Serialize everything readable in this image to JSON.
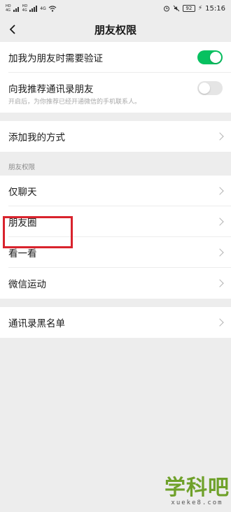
{
  "status_bar": {
    "left_tags": [
      "HD",
      "4G",
      "HD",
      "4G",
      "4G"
    ],
    "battery": "92",
    "time": "15:16"
  },
  "nav": {
    "title": "朋友权限",
    "back_icon": "back-arrow-icon"
  },
  "verification": {
    "require_verify_label": "加我为朋友时需要验证",
    "require_verify_on": true,
    "recommend_contacts_label": "向我推荐通讯录朋友",
    "recommend_contacts_on": false,
    "recommend_hint": "开启后，为你推荐已经开通微信的手机联系人。"
  },
  "add_methods": {
    "label": "添加我的方式"
  },
  "friend_permissions": {
    "section_label": "朋友权限",
    "items": [
      {
        "label": "仅聊天"
      },
      {
        "label": "朋友圈"
      },
      {
        "label": "看一看"
      },
      {
        "label": "微信运动"
      }
    ]
  },
  "blacklist": {
    "label": "通讯录黑名单"
  },
  "watermark": {
    "main": "学科吧",
    "sub": "xueke8.com"
  },
  "colors": {
    "accent": "#07c160",
    "highlight": "#d9232d",
    "watermark": "#6fa12a"
  }
}
